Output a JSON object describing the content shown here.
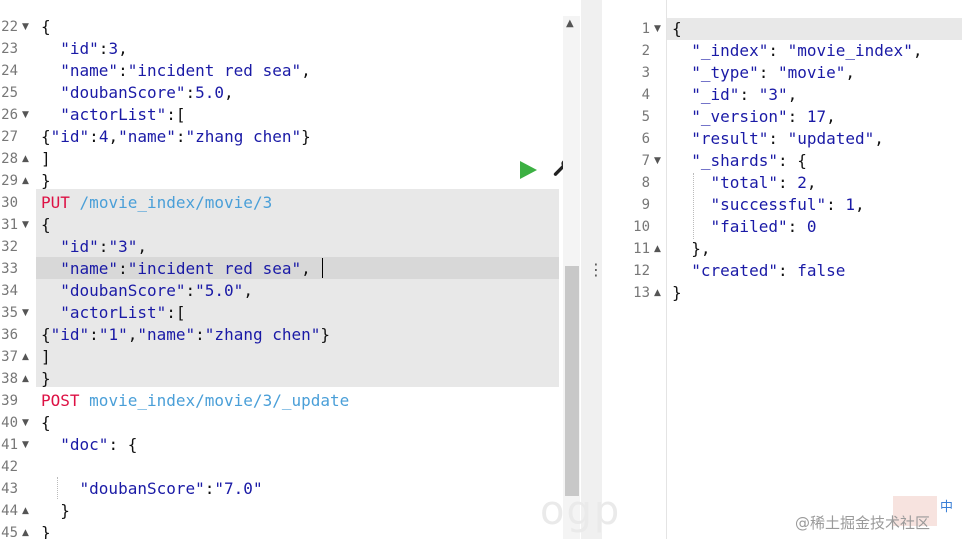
{
  "left_editor": {
    "lines": [
      {
        "n": "22",
        "fold": true,
        "html": "<span class='p'>{</span>"
      },
      {
        "n": "23",
        "fold": false,
        "html": "  <span class='k'>\"id\"</span><span class='p'>:</span><span class='b'>3</span><span class='p'>,</span>"
      },
      {
        "n": "24",
        "fold": false,
        "html": "  <span class='k'>\"name\"</span><span class='p'>:</span><span class='s'>\"incident red sea\"</span><span class='p'>,</span>"
      },
      {
        "n": "25",
        "fold": false,
        "html": "  <span class='k'>\"doubanScore\"</span><span class='p'>:</span><span class='b'>5.0</span><span class='p'>,</span>"
      },
      {
        "n": "26",
        "fold": true,
        "html": "  <span class='k'>\"actorList\"</span><span class='p'>:[</span>"
      },
      {
        "n": "27",
        "fold": false,
        "html": "<span class='p'>{</span><span class='k'>\"id\"</span><span class='p'>:</span><span class='b'>4</span><span class='p'>,</span><span class='k'>\"name\"</span><span class='p'>:</span><span class='s'>\"zhang chen\"</span><span class='p'>}</span>"
      },
      {
        "n": "28",
        "fold": true,
        "html": "<span class='p'>]</span>"
      },
      {
        "n": "29",
        "fold": true,
        "html": "<span class='p'>}</span>"
      },
      {
        "n": "30",
        "fold": false,
        "html": "<span class='m'>PUT</span> <span class='u'>/movie_index/movie/3</span>"
      },
      {
        "n": "31",
        "fold": true,
        "html": "<span class='p'>{</span>"
      },
      {
        "n": "32",
        "fold": false,
        "html": "  <span class='k'>\"id\"</span><span class='p'>:</span><span class='s'>\"3\"</span><span class='p'>,</span>"
      },
      {
        "n": "33",
        "fold": false,
        "html": "  <span class='k'>\"name\"</span><span class='p'>:</span><span class='s'>\"incident red sea\"</span><span class='p'>,</span>"
      },
      {
        "n": "34",
        "fold": false,
        "html": "  <span class='k'>\"doubanScore\"</span><span class='p'>:</span><span class='s'>\"5.0\"</span><span class='p'>,</span>"
      },
      {
        "n": "35",
        "fold": true,
        "html": "  <span class='k'>\"actorList\"</span><span class='p'>:[</span>"
      },
      {
        "n": "36",
        "fold": false,
        "html": "<span class='p'>{</span><span class='k'>\"id\"</span><span class='p'>:</span><span class='s'>\"1\"</span><span class='p'>,</span><span class='k'>\"name\"</span><span class='p'>:</span><span class='s'>\"zhang chen\"</span><span class='p'>}</span>"
      },
      {
        "n": "37",
        "fold": true,
        "html": "<span class='p'>]</span>"
      },
      {
        "n": "38",
        "fold": true,
        "html": "<span class='p'>}</span>"
      },
      {
        "n": "39",
        "fold": false,
        "html": "<span class='m'>POST</span> <span class='u'>movie_index/movie/3/_update</span>"
      },
      {
        "n": "40",
        "fold": true,
        "html": "<span class='p'>{</span>"
      },
      {
        "n": "41",
        "fold": true,
        "html": "  <span class='k'>\"doc\"</span><span class='p'>: {</span>"
      },
      {
        "n": "42",
        "fold": false,
        "html": ""
      },
      {
        "n": "43",
        "fold": false,
        "html": "    <span class='k'>\"doubanScore\"</span><span class='p'>:</span><span class='s'>\"7.0\"</span>"
      },
      {
        "n": "44",
        "fold": true,
        "html": "  <span class='p'>}</span>"
      },
      {
        "n": "45",
        "fold": true,
        "html": "<span class='p'>}</span>"
      }
    ]
  },
  "right_editor": {
    "lines": [
      {
        "n": "1",
        "fold": true,
        "html": "<span class='p'>{</span>"
      },
      {
        "n": "2",
        "fold": false,
        "html": "  <span class='k'>\"_index\"</span><span class='p'>: </span><span class='s'>\"movie_index\"</span><span class='p'>,</span>"
      },
      {
        "n": "3",
        "fold": false,
        "html": "  <span class='k'>\"_type\"</span><span class='p'>: </span><span class='s'>\"movie\"</span><span class='p'>,</span>"
      },
      {
        "n": "4",
        "fold": false,
        "html": "  <span class='k'>\"_id\"</span><span class='p'>: </span><span class='s'>\"3\"</span><span class='p'>,</span>"
      },
      {
        "n": "5",
        "fold": false,
        "html": "  <span class='k'>\"_version\"</span><span class='p'>: </span><span class='b'>17</span><span class='p'>,</span>"
      },
      {
        "n": "6",
        "fold": false,
        "html": "  <span class='k'>\"result\"</span><span class='p'>: </span><span class='s'>\"updated\"</span><span class='p'>,</span>"
      },
      {
        "n": "7",
        "fold": true,
        "html": "  <span class='k'>\"_shards\"</span><span class='p'>: {</span>"
      },
      {
        "n": "8",
        "fold": false,
        "html": "    <span class='k'>\"total\"</span><span class='p'>: </span><span class='b'>2</span><span class='p'>,</span>"
      },
      {
        "n": "9",
        "fold": false,
        "html": "    <span class='k'>\"successful\"</span><span class='p'>: </span><span class='b'>1</span><span class='p'>,</span>"
      },
      {
        "n": "10",
        "fold": false,
        "html": "    <span class='k'>\"failed\"</span><span class='p'>: </span><span class='b'>0</span>"
      },
      {
        "n": "11",
        "fold": true,
        "html": "  <span class='p'>},</span>"
      },
      {
        "n": "12",
        "fold": false,
        "html": "  <span class='k'>\"created\"</span><span class='p'>: </span><span class='b'>false</span>"
      },
      {
        "n": "13",
        "fold": true,
        "html": "<span class='p'>}</span>"
      }
    ]
  },
  "watermark": {
    "text": "@稀土掘金技术社区",
    "background_text": "ogp"
  }
}
